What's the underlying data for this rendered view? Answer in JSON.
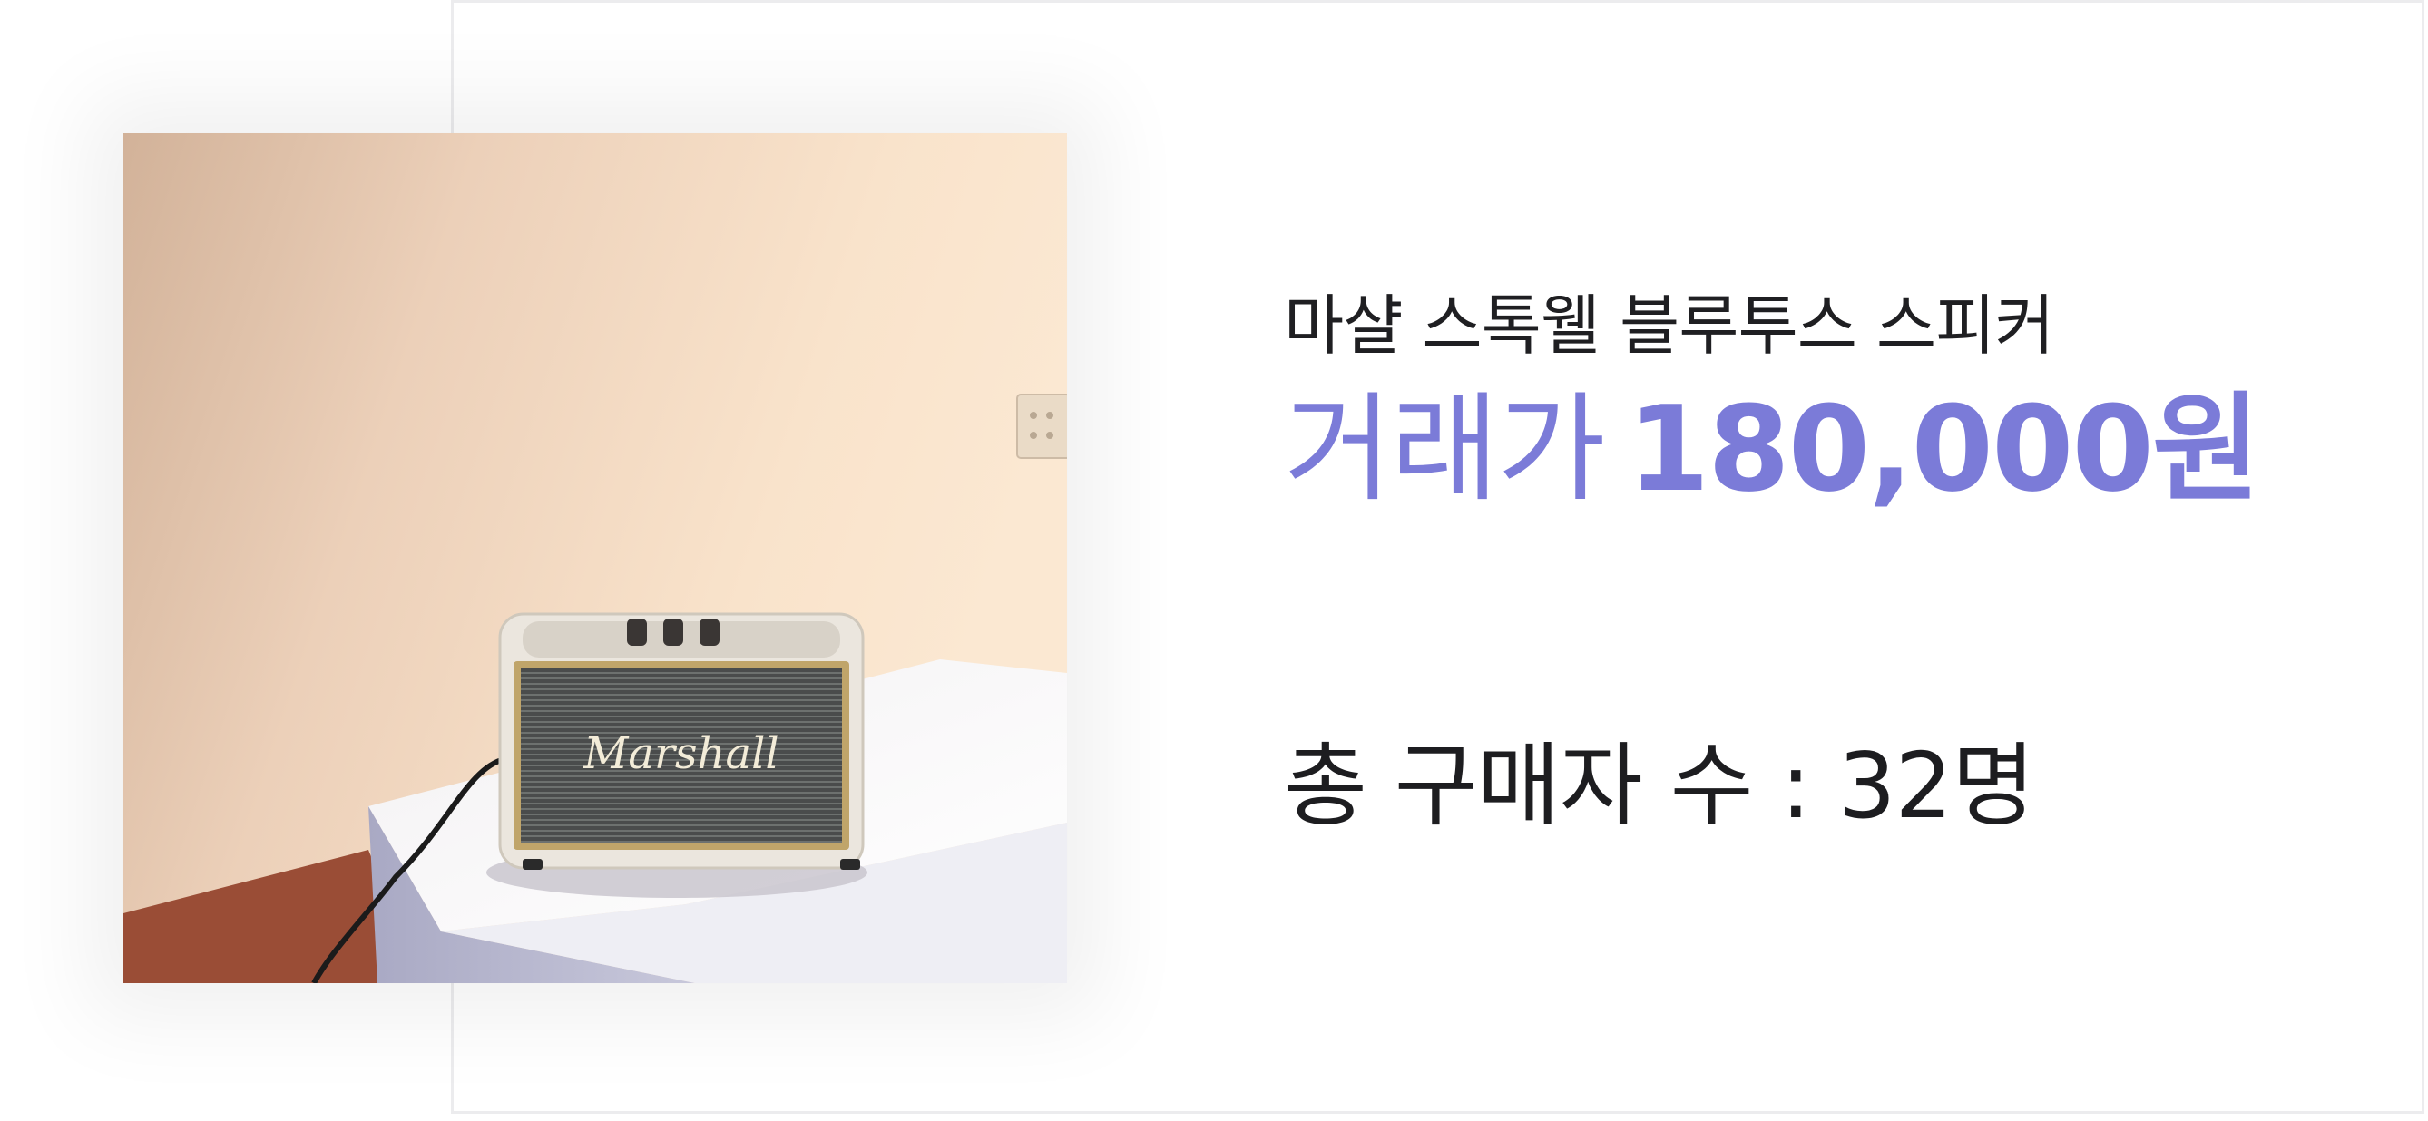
{
  "product": {
    "title": "마샬 스톡웰 블루투스 스피커",
    "price_label": "거래가",
    "price_value": "180,000원",
    "buyers_text": "총 구매자 수 : 32명",
    "speaker_brand": "Marshall"
  },
  "colors": {
    "accent": "#7b7bd8",
    "text": "#1f1f22",
    "border": "#ececee"
  }
}
